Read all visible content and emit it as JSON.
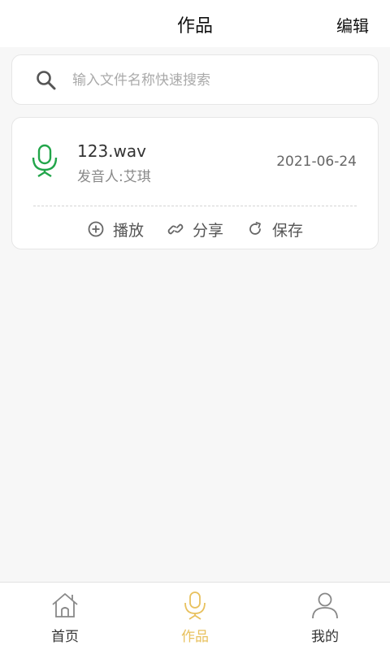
{
  "header": {
    "title": "作品",
    "edit_label": "编辑"
  },
  "search": {
    "placeholder": "输入文件名称快速搜索",
    "value": ""
  },
  "works": [
    {
      "filename": "123.wav",
      "speaker": "发音人:艾琪",
      "date": "2021-06-24",
      "actions": {
        "play": "播放",
        "share": "分享",
        "save": "保存"
      }
    }
  ],
  "tabbar": {
    "items": [
      {
        "label": "首页",
        "icon": "home-icon",
        "active": false
      },
      {
        "label": "作品",
        "icon": "microphone-icon",
        "active": true
      },
      {
        "label": "我的",
        "icon": "user-icon",
        "active": false
      }
    ]
  },
  "colors": {
    "accent": "#e8c15e",
    "mic_green": "#22a54a",
    "text_gray": "#888888"
  }
}
